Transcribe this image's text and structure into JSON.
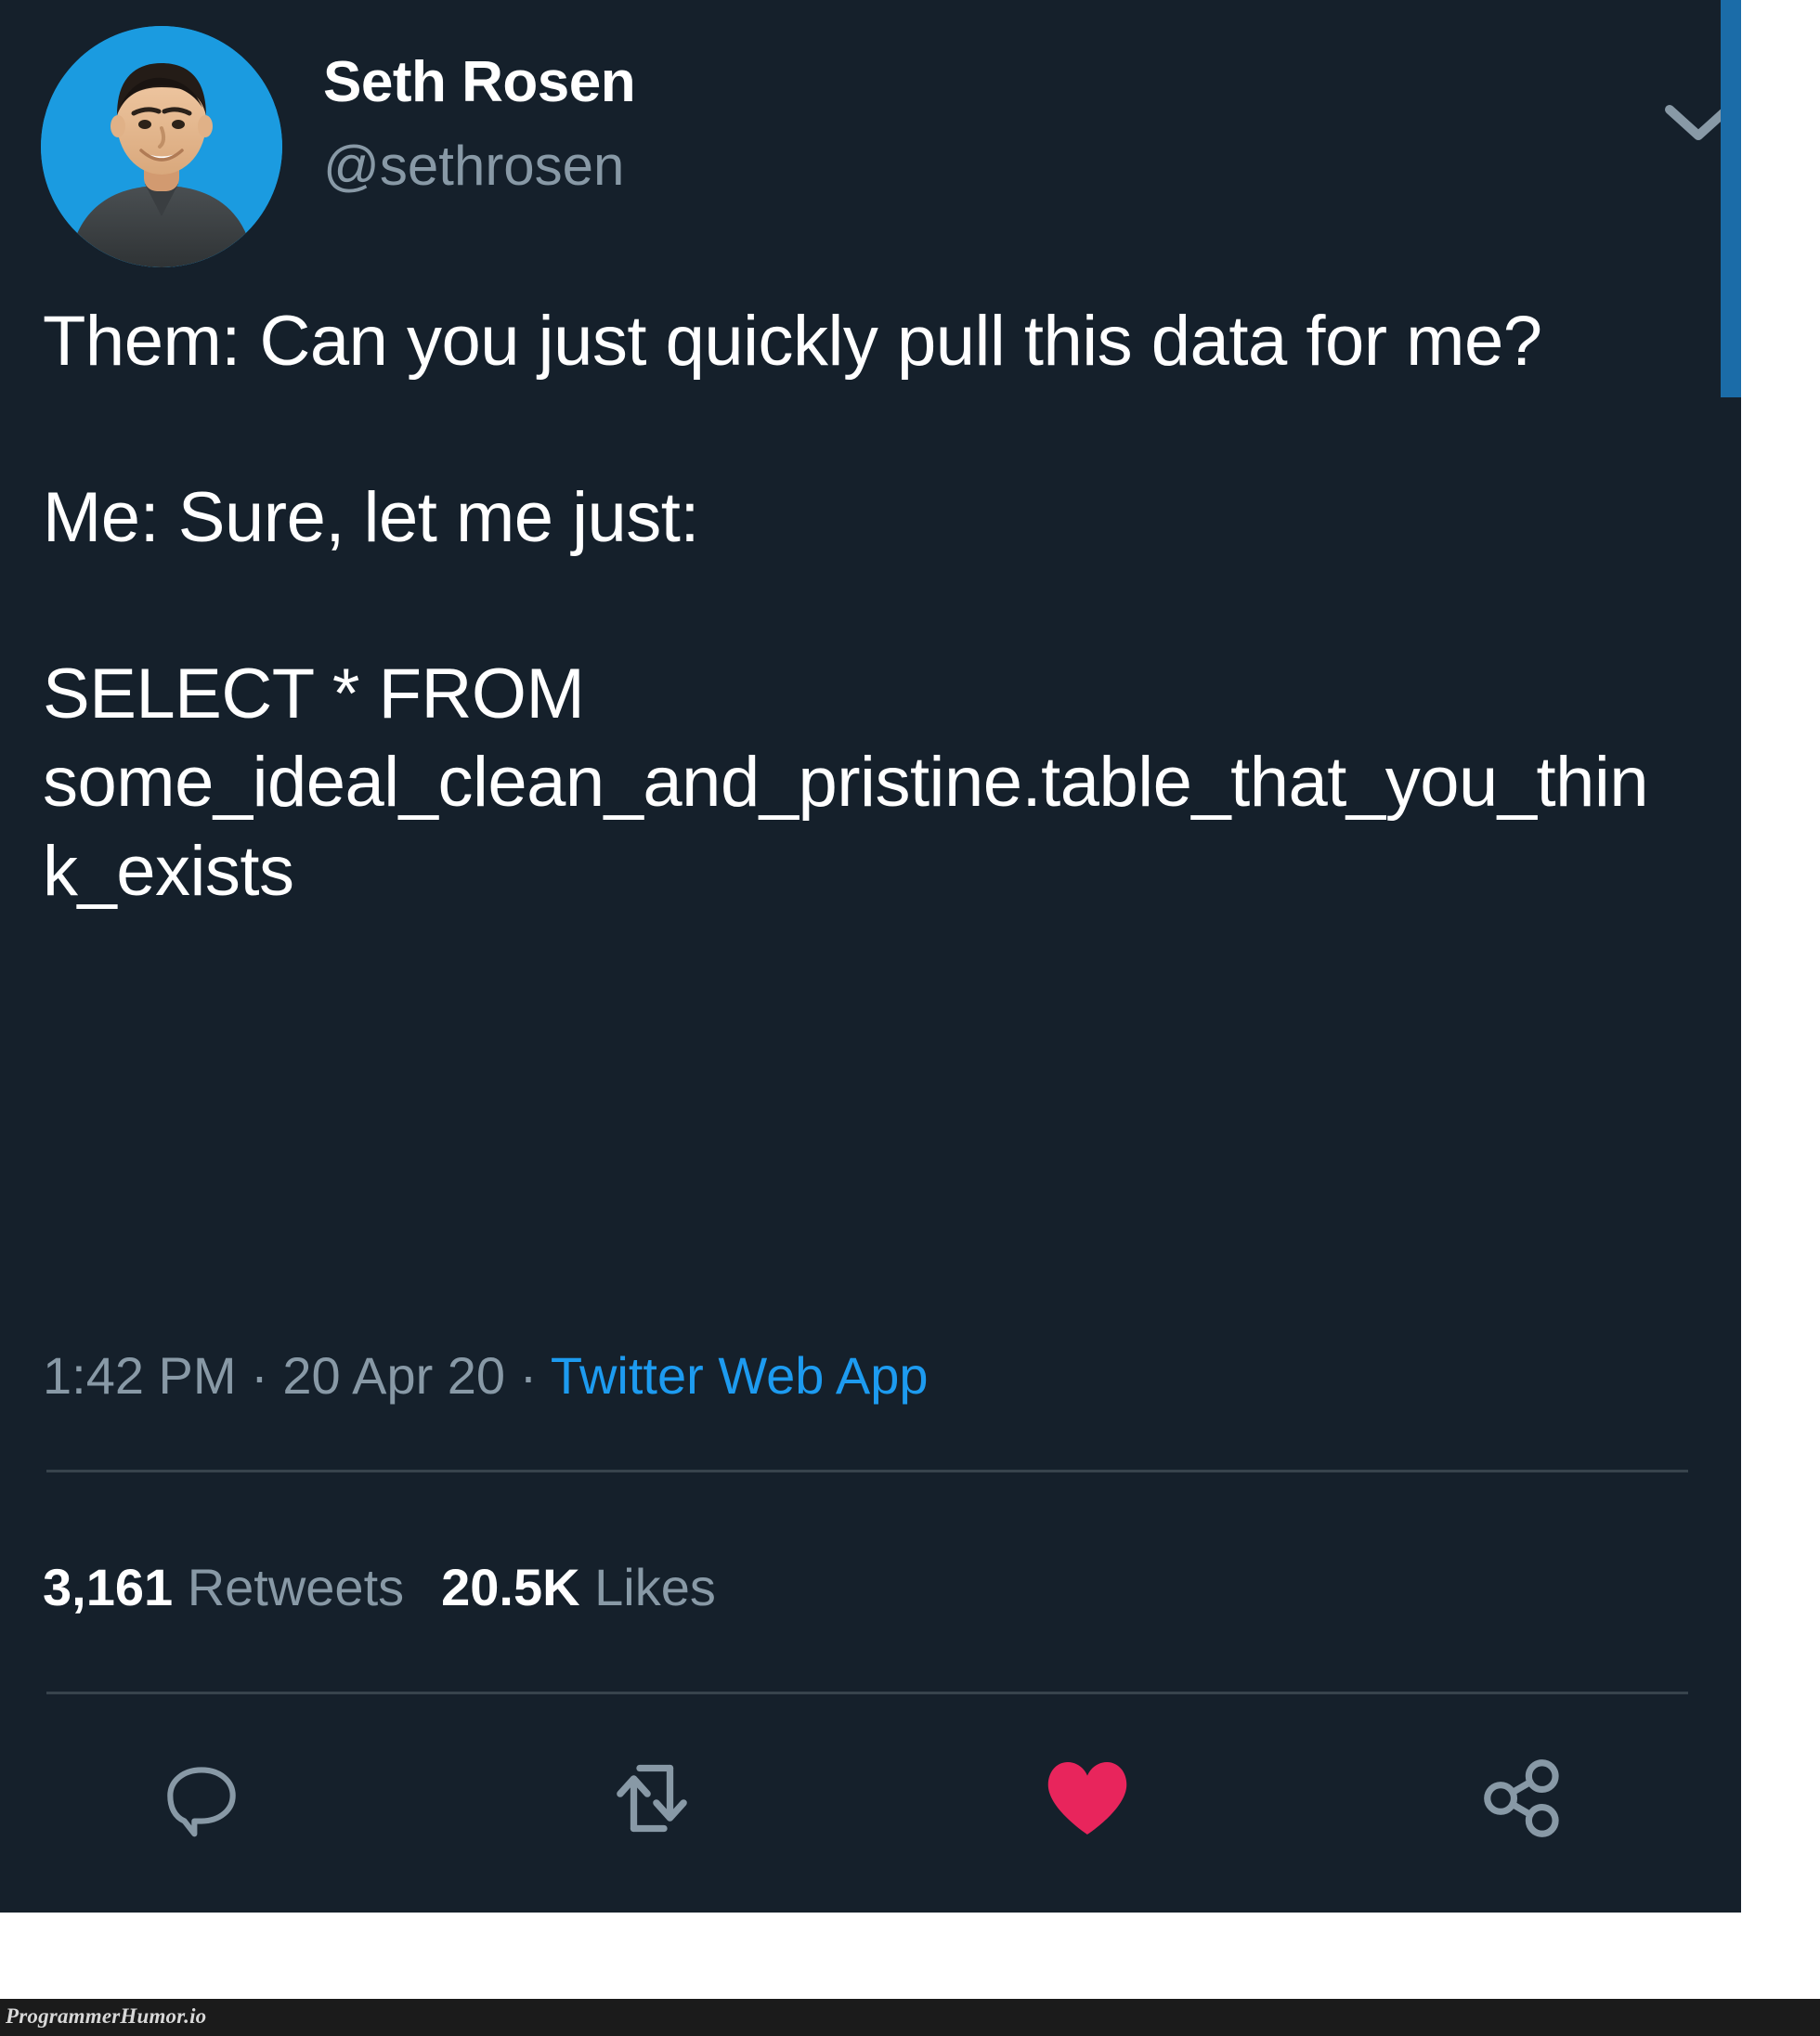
{
  "tweet": {
    "author": {
      "display_name": "Seth Rosen",
      "handle": "@sethrosen",
      "avatar_alt": "seth-rosen-profile-photo"
    },
    "body_lines": [
      "Them: Can you just quickly pull this data for me?",
      "",
      "Me: Sure, let me just:",
      "",
      "SELECT * FROM some_ideal_clean_and_pristine.table_that_you_think_exists"
    ],
    "body_text": "Them: Can you just quickly pull this data for me?\n\nMe: Sure, let me just:\n\nSELECT * FROM some_ideal_clean_and_pristine.table_that_you_think_exists",
    "meta": {
      "time": "1:42 PM",
      "separator": "·",
      "date": "20 Apr 20",
      "source": "Twitter Web App"
    },
    "stats": {
      "retweets_count": "3,161",
      "retweets_label": "Retweets",
      "likes_count": "20.5K",
      "likes_label": "Likes"
    },
    "actions": [
      {
        "name": "reply",
        "icon": "reply-icon",
        "active": false
      },
      {
        "name": "retweet",
        "icon": "retweet-icon",
        "active": false
      },
      {
        "name": "like",
        "icon": "heart-icon",
        "active": true
      },
      {
        "name": "share",
        "icon": "share-icon",
        "active": false
      }
    ],
    "caret_icon": "chevron-down-icon"
  },
  "watermark": {
    "text": "ProgrammerHumor.io"
  },
  "colors": {
    "background": "#15202b",
    "page_background": "#ffffff",
    "text_primary": "#ffffff",
    "text_secondary": "#8899a6",
    "link": "#1d9bf0",
    "like_active": "#e8255c",
    "divider": "#38444d",
    "scrollbar_thumb": "#1b6ca8",
    "avatar_background": "#1b9be0",
    "watermark_bar": "#1b1b1b"
  }
}
